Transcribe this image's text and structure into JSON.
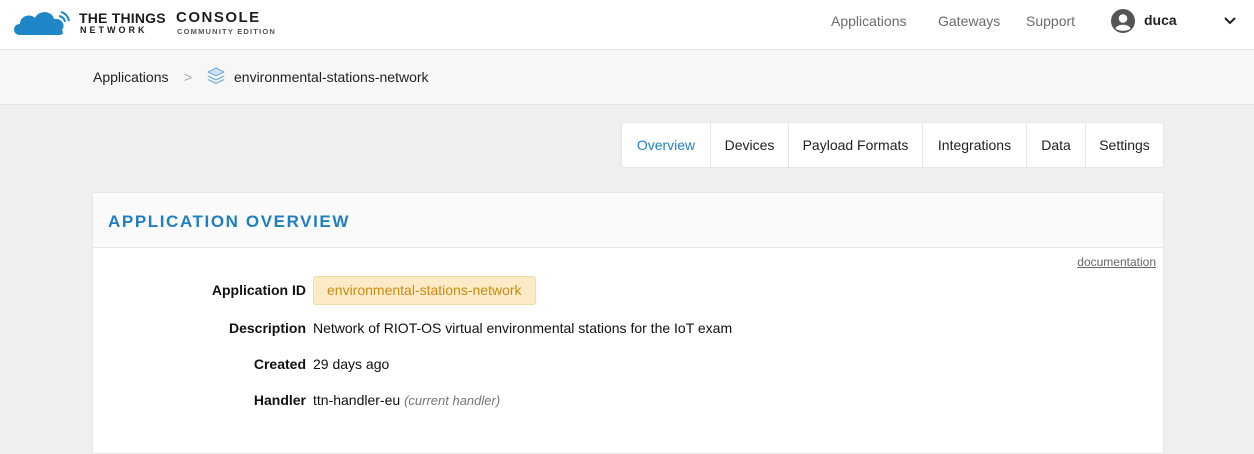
{
  "header": {
    "brand": "THE THINGS",
    "brand_sub": "NETWORK",
    "console": "CONSOLE",
    "console_sub": "COMMUNITY EDITION",
    "nav": [
      "Applications",
      "Gateways",
      "Support"
    ],
    "username": "duca"
  },
  "breadcrumb": {
    "root": "Applications",
    "separator": ">",
    "current": "environmental-stations-network"
  },
  "tabs": [
    "Overview",
    "Devices",
    "Payload Formats",
    "Integrations",
    "Data",
    "Settings"
  ],
  "active_tab": "Overview",
  "card": {
    "title": "APPLICATION OVERVIEW",
    "documentation_link": "documentation",
    "fields": {
      "app_id_label": "Application ID",
      "app_id_value": "environmental-stations-network",
      "description_label": "Description",
      "description_value": "Network of RIOT-OS virtual environmental stations for the IoT exam",
      "created_label": "Created",
      "created_value": "29 days ago",
      "handler_label": "Handler",
      "handler_value": "ttn-handler-eu",
      "handler_note": "(current handler)"
    }
  },
  "colors": {
    "accent": "#1f7fc3",
    "badge_bg": "#fcebc6",
    "badge_text": "#c88a12"
  }
}
